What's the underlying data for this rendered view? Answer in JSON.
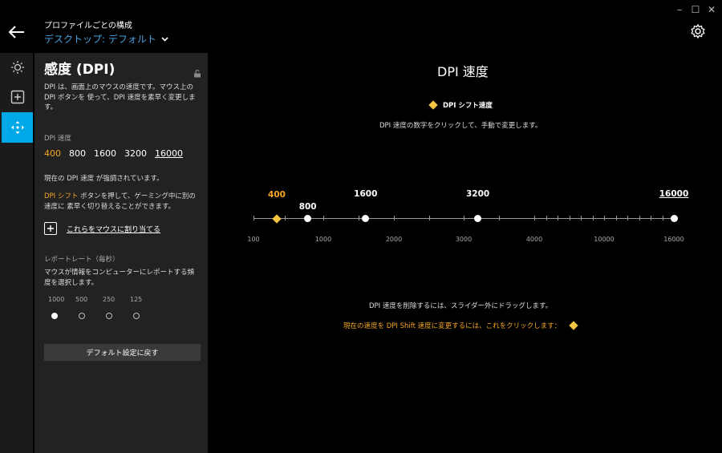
{
  "window": {
    "minimize": "–",
    "maximize": "☐",
    "close": "✕"
  },
  "header": {
    "profile_label": "プロファイルごとの構成",
    "profile_value": "デスクトップ: デフォルト"
  },
  "rail": {
    "items": [
      "lighting-icon",
      "add-icon",
      "move-icon"
    ],
    "accent": "#00a8e8"
  },
  "panel": {
    "title": "感度 (DPI)",
    "description": "DPI は、画面上のマウスの速度です。マウス上の DPI ボタンを 使って、DPI 速度を素早く変更します。",
    "dpi_label": "DPI 速度",
    "dpi_values": [
      "400",
      "800",
      "1600",
      "3200",
      "16000"
    ],
    "current_note": "現在の DPI 速度 が強調されています。",
    "shift_note_highlight": "DPI シフト",
    "shift_note_rest": " ボタンを押して、ゲーミング中に別の速度に 素早く切り替えることができます。",
    "assign_label": "これらをマウスに割り当てる",
    "report_rate_label": "レポートレート（毎秒）",
    "report_rate_desc": "マウスが情報をコンピューターにレポートする頻度を選択します。",
    "report_rates": [
      "1000",
      "500",
      "250",
      "125"
    ],
    "report_rate_selected": "1000",
    "reset_label": "デフォルト設定に戻す"
  },
  "main": {
    "title": "DPI 速度",
    "shift_label": "DPI シフト速度",
    "hint": "DPI 速度の数字をクリックして、手動で変更します。",
    "slider_values": [
      {
        "label": "400",
        "value": 400,
        "shift": true
      },
      {
        "label": "800",
        "value": 800
      },
      {
        "label": "1600",
        "value": 1600
      },
      {
        "label": "3200",
        "value": 3200
      },
      {
        "label": "16000",
        "value": 16000
      }
    ],
    "axis_labels": [
      "100",
      "1000",
      "2000",
      "3000",
      "4000",
      "10000",
      "16000"
    ],
    "drag_hint": "DPI 速度を削除するには、スライダー外にドラッグします。",
    "shift_change_hint": "現在の速度を DPI Shift 速度に変更するには、これをクリックします："
  },
  "colors": {
    "accent_orange": "#f5a623",
    "shift_diamond": "#f5c542",
    "link_blue": "#4aa3df"
  }
}
